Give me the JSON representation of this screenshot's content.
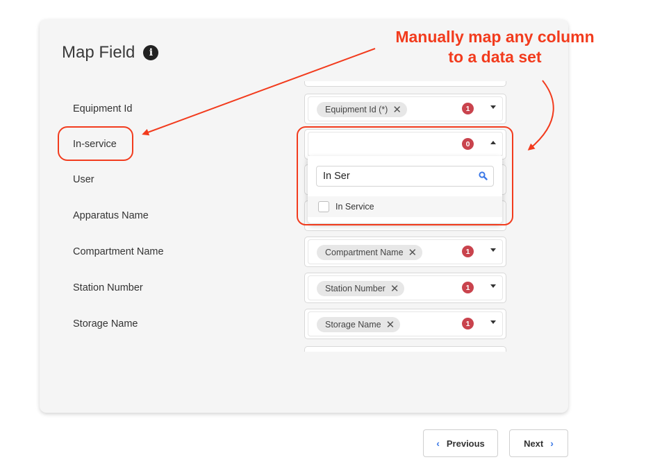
{
  "card": {
    "title": "Map Field",
    "info_icon": "info-icon"
  },
  "fields": [
    {
      "label": "Equipment Id",
      "chip": "Equipment Id (*)",
      "badge": "1"
    },
    {
      "label": "In-service",
      "chip": "",
      "badge": "0"
    },
    {
      "label": "User"
    },
    {
      "label": "Apparatus Name"
    },
    {
      "label": "Compartment Name",
      "chip": "Compartment Name",
      "badge": "1"
    },
    {
      "label": "Station Number",
      "chip": "Station Number",
      "badge": "1"
    },
    {
      "label": "Storage Name",
      "chip": "Storage Name",
      "badge": "1"
    }
  ],
  "chip_remove": "✕",
  "dropdown": {
    "search_value": "In Ser",
    "options": [
      {
        "label": "In Service",
        "checked": false
      }
    ]
  },
  "annotation": {
    "line1": "Manually map any column",
    "line2": "to a data set",
    "color": "#f23b1d"
  },
  "buttons": {
    "previous": "Previous",
    "next": "Next",
    "prev_chevron": "‹",
    "next_chevron": "›"
  },
  "colors": {
    "badge": "#c9434d",
    "accent": "#3b78e7",
    "card_bg": "#f5f5f5"
  }
}
